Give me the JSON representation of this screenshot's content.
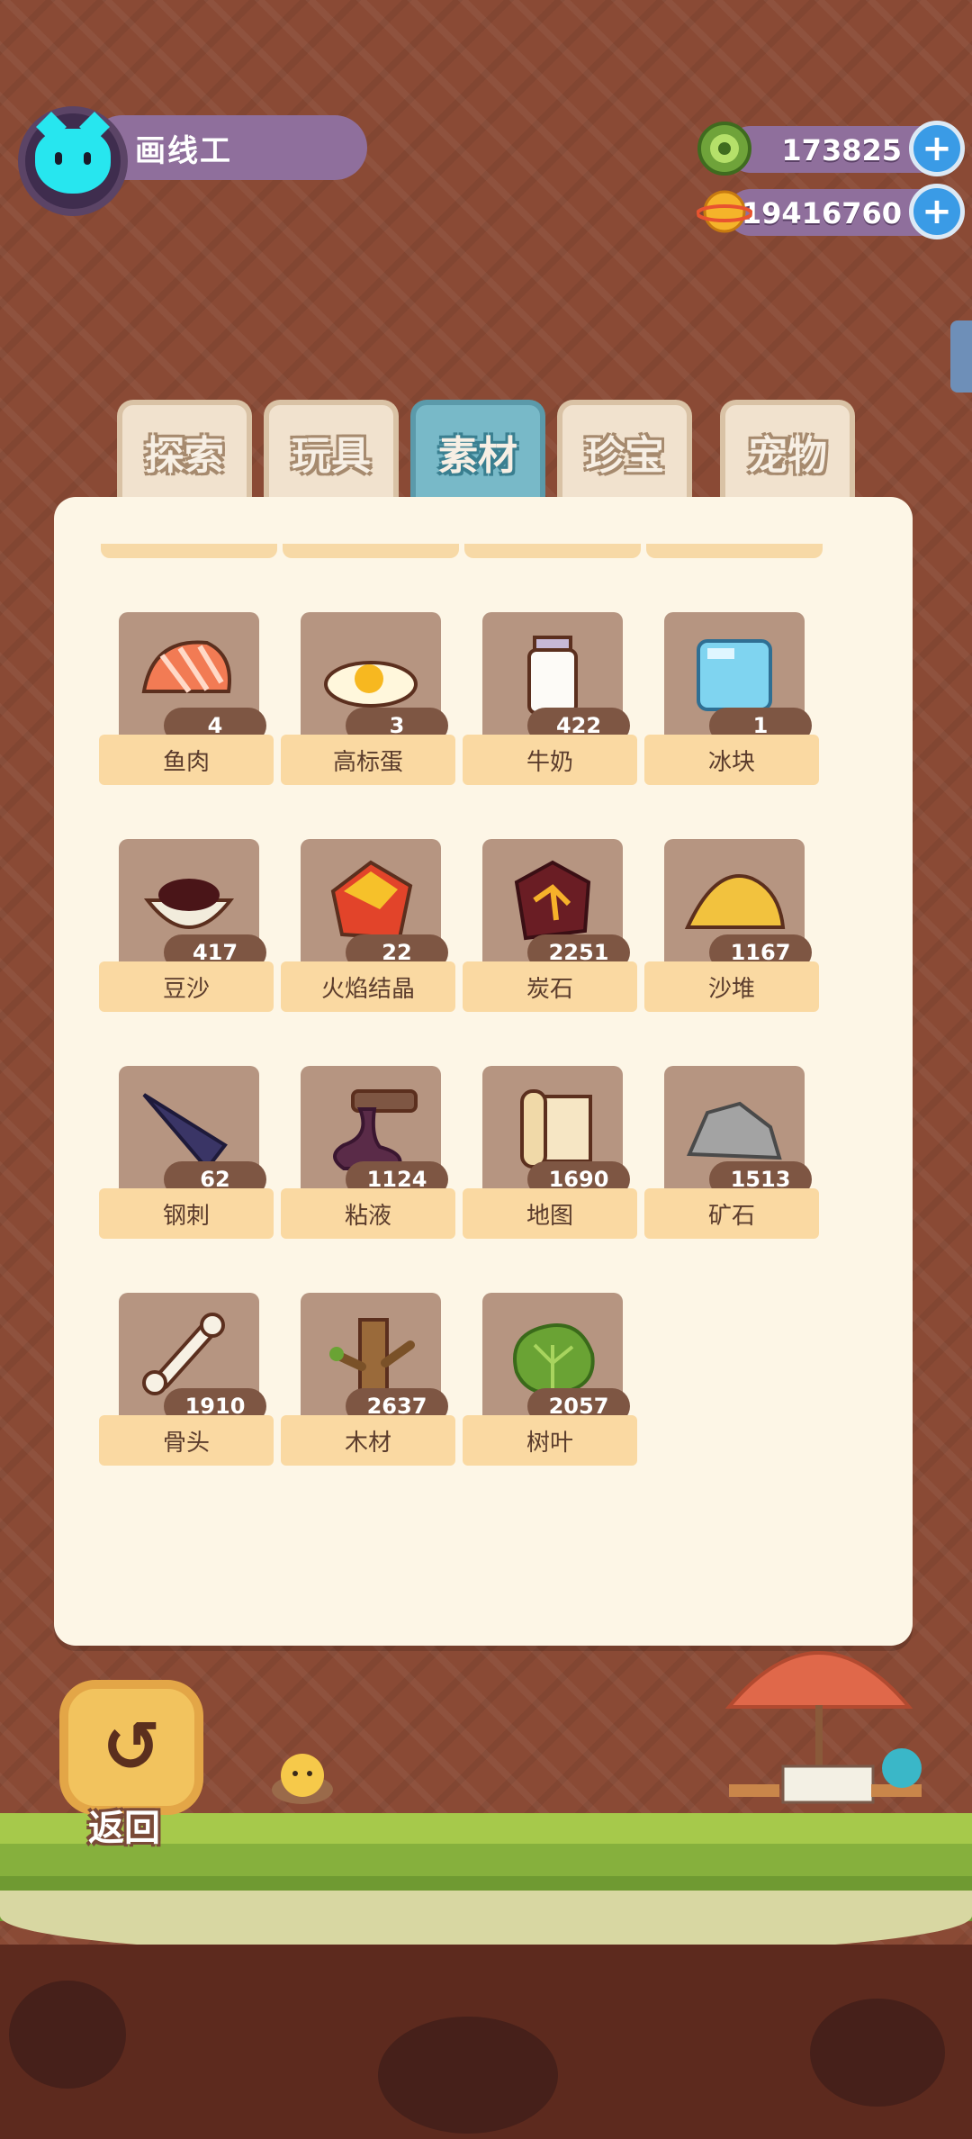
{
  "player": {
    "name": "画线工"
  },
  "currencies": [
    {
      "name": "green-coin",
      "value": "173825",
      "color": "#8bc34a"
    },
    {
      "name": "gold-planet",
      "value": "19416760",
      "color": "#f5a623"
    }
  ],
  "tabs": [
    {
      "label": "探索",
      "active": false
    },
    {
      "label": "玩具",
      "active": false
    },
    {
      "label": "素材",
      "active": true
    },
    {
      "label": "珍宝",
      "active": false
    },
    {
      "label": "宠物",
      "active": false
    }
  ],
  "items": [
    {
      "label": "鱼肉",
      "count": "4",
      "icon": "salmon-icon"
    },
    {
      "label": "高标蛋",
      "count": "3",
      "icon": "fried-egg-icon"
    },
    {
      "label": "牛奶",
      "count": "422",
      "icon": "milk-bottle-icon"
    },
    {
      "label": "冰块",
      "count": "1",
      "icon": "ice-cube-icon"
    },
    {
      "label": "豆沙",
      "count": "417",
      "icon": "red-bean-paste-icon"
    },
    {
      "label": "火焰结晶",
      "count": "22",
      "icon": "flame-crystal-icon"
    },
    {
      "label": "炭石",
      "count": "2251",
      "icon": "charcoal-stone-icon"
    },
    {
      "label": "沙堆",
      "count": "1167",
      "icon": "sand-pile-icon"
    },
    {
      "label": "钢刺",
      "count": "62",
      "icon": "steel-spike-icon"
    },
    {
      "label": "粘液",
      "count": "1124",
      "icon": "slime-icon"
    },
    {
      "label": "地图",
      "count": "1690",
      "icon": "map-scroll-icon"
    },
    {
      "label": "矿石",
      "count": "1513",
      "icon": "ore-rock-icon"
    },
    {
      "label": "骨头",
      "count": "1910",
      "icon": "bone-icon"
    },
    {
      "label": "木材",
      "count": "2637",
      "icon": "wood-log-icon"
    },
    {
      "label": "树叶",
      "count": "2057",
      "icon": "leaves-icon"
    }
  ],
  "back": {
    "label": "返回",
    "glyph": "↺"
  },
  "plus": "+"
}
